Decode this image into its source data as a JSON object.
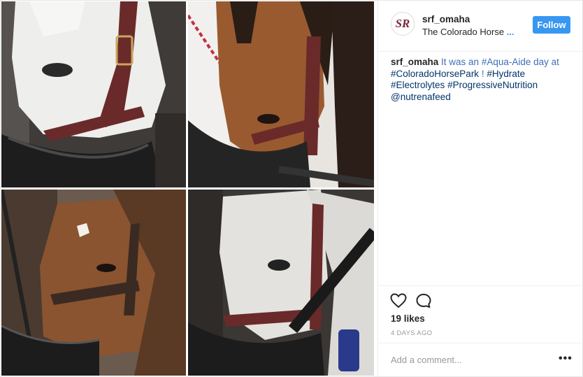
{
  "post": {
    "username": "srf_omaha",
    "location": "The Colorado Horse",
    "location_more": "...",
    "avatar_initials": "SR",
    "follow_label": "Follow",
    "caption": {
      "username": "srf_omaha",
      "parts": [
        {
          "text": " It was an ",
          "kind": "plain"
        },
        {
          "text": "#Aqua-Aide",
          "kind": "tag"
        },
        {
          "text": " day at ",
          "kind": "plain"
        },
        {
          "text": "#ColoradoHorsePark",
          "kind": "tag"
        },
        {
          "text": " ! ",
          "kind": "plain"
        },
        {
          "text": "#Hydrate",
          "kind": "tag"
        },
        {
          "text": "#Electrolytes",
          "kind": "tag"
        },
        {
          "text": " ",
          "kind": "plain"
        },
        {
          "text": "#ProgressiveNutrition",
          "kind": "tag"
        },
        {
          "text": "@nutrenafeed",
          "kind": "mention"
        }
      ]
    },
    "likes": "19 likes",
    "time_ago": "4 DAYS AGO",
    "comment_placeholder": "Add a comment...",
    "more_options": "•••",
    "icons": {
      "like": "heart-icon",
      "comment": "comment-bubble-icon",
      "options": "more-options-icon"
    },
    "colors": {
      "follow": "#3897f0",
      "text": "#262626",
      "muted": "#999999"
    },
    "photos": [
      {
        "name": "white-horse-drinking-bucket"
      },
      {
        "name": "bay-horse-drinking-bucket"
      },
      {
        "name": "bay-horse-with-star-drinking"
      },
      {
        "name": "grey-horse-drinking-bucket"
      }
    ]
  }
}
